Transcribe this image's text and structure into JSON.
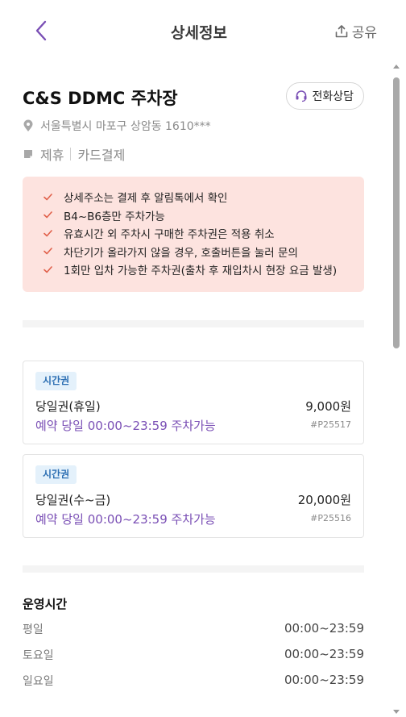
{
  "header": {
    "title": "상세정보",
    "share_label": "공유"
  },
  "lot": {
    "name": "C&S DDMC 주차장",
    "call_label": "전화상담",
    "address": "서울특별시 마포구 상암동 1610***",
    "tags": [
      "제휴",
      "카드결제"
    ]
  },
  "notices": [
    "상세주소는 결제 후 알림톡에서 확인",
    "B4~B6층만 주차가능",
    "유효시간 외 주차시 구매한 주차권은 적용 취소",
    "차단기가 올라가지 않을 경우, 호출버튼을 눌러 문의",
    "1회만 입차 가능한 주차권(출차 후 재입차시 현장 요금 발생)"
  ],
  "tickets": [
    {
      "badge": "시간권",
      "name": "당일권(휴일)",
      "price": "9,000원",
      "time": "예약 당일 00:00~23:59 주차가능",
      "code": "#P25517"
    },
    {
      "badge": "시간권",
      "name": "당일권(수~금)",
      "price": "20,000원",
      "time": "예약 당일 00:00~23:59 주차가능",
      "code": "#P25516"
    }
  ],
  "hours": {
    "title": "운영시간",
    "rows": [
      {
        "day": "평일",
        "time": "00:00~23:59"
      },
      {
        "day": "토요일",
        "time": "00:00~23:59"
      },
      {
        "day": "일요일",
        "time": "00:00~23:59"
      }
    ]
  },
  "colors": {
    "accent": "#7a4fb5",
    "notice_bg": "#fde3df",
    "check": "#e0604a",
    "badge_bg": "#e4f1fb"
  }
}
